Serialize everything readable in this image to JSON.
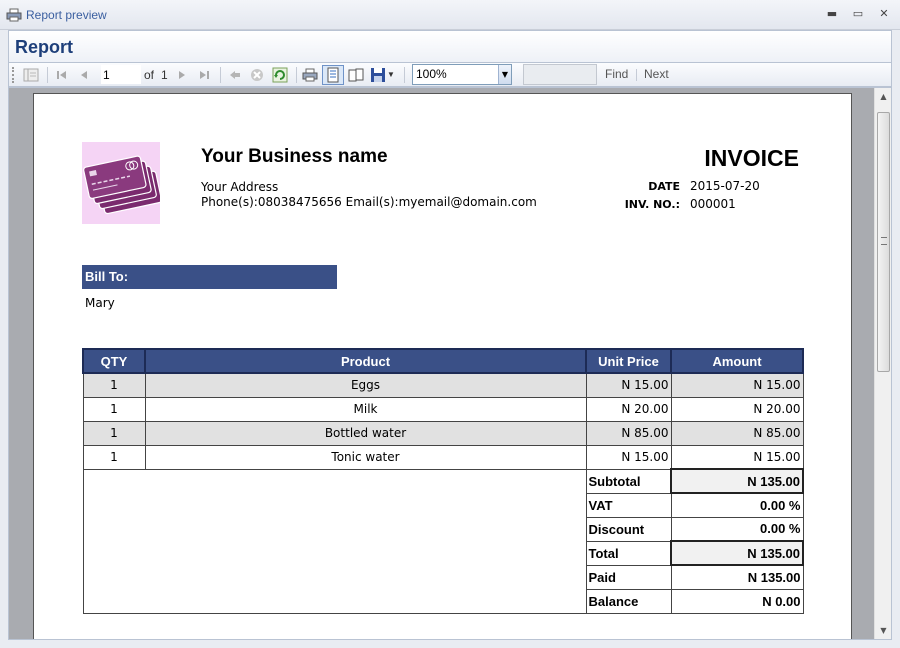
{
  "window": {
    "title": "Report preview",
    "controls": {
      "minimize": "▬",
      "maximize": "▭",
      "close": "✕"
    }
  },
  "report_header": {
    "title": "Report"
  },
  "toolbar": {
    "page_value": "1",
    "of_label": "of",
    "total_pages": "1",
    "zoom": "100%",
    "find_label": "Find",
    "next_label": "Next",
    "find_placeholder": ""
  },
  "invoice": {
    "business_name": "Your Business name",
    "address": "Your Address",
    "contact": "Phone(s):08038475656 Email(s):myemail@domain.com",
    "title": "INVOICE",
    "date_label": "DATE",
    "date_value": "2015-07-20",
    "invno_label": "INV. NO.:",
    "invno_value": "000001",
    "bill_to_label": "Bill To:",
    "bill_to_name": "Mary",
    "columns": {
      "qty": "QTY",
      "product": "Product",
      "unit_price": "Unit Price",
      "amount": "Amount"
    },
    "rows": [
      {
        "qty": "1",
        "product": "Eggs",
        "unit_price": "N 15.00",
        "amount": "N 15.00"
      },
      {
        "qty": "1",
        "product": "Milk",
        "unit_price": "N 20.00",
        "amount": "N 20.00"
      },
      {
        "qty": "1",
        "product": "Bottled water",
        "unit_price": "N 85.00",
        "amount": "N 85.00"
      },
      {
        "qty": "1",
        "product": "Tonic water",
        "unit_price": "N 15.00",
        "amount": "N 15.00"
      }
    ],
    "totals": {
      "subtotal_label": "Subtotal",
      "subtotal": "N 135.00",
      "vat_label": "VAT",
      "vat": "0.00 %",
      "discount_label": "Discount",
      "discount": "0.00 %",
      "total_label": "Total",
      "total": "N 135.00",
      "paid_label": "Paid",
      "paid": "N 135.00",
      "balance_label": "Balance",
      "balance": "N 0.00"
    }
  },
  "colors": {
    "header_blue": "#3a5087",
    "logo_bg": "#f5d4f5",
    "card_purple": "#7a2a6e"
  },
  "icons": [
    "printer-app-icon",
    "document-map-icon",
    "first-page-icon",
    "prev-page-icon",
    "next-page-icon",
    "last-page-icon",
    "back-icon",
    "stop-icon",
    "refresh-icon",
    "print-icon",
    "print-layout-icon",
    "page-setup-icon",
    "save-icon"
  ]
}
